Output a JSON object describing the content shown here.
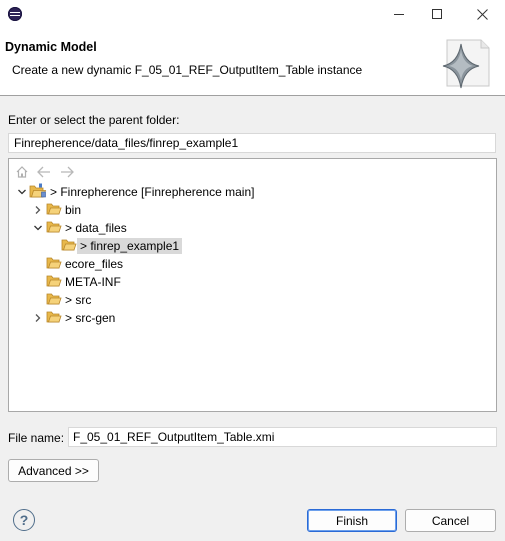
{
  "window": {
    "icon": "eclipse-icon",
    "controls": {
      "minimize": "minimize-icon",
      "maximize": "maximize-icon",
      "close": "close-icon"
    }
  },
  "banner": {
    "title": "Dynamic Model",
    "description": "Create a new dynamic F_05_01_REF_OutputItem_Table instance",
    "image": "wizard-banner-sparkle"
  },
  "folder": {
    "label": "Enter or select the parent folder:",
    "value": "Finrepherence/data_files/finrep_example1"
  },
  "tree_toolbar": {
    "home": "home-icon",
    "back": "back-arrow-icon",
    "forward": "forward-arrow-icon"
  },
  "tree": [
    {
      "label": "> Finrepherence [Finrepherence main]",
      "icon": "project-folder-icon",
      "state": "expanded"
    },
    {
      "label": "bin",
      "icon": "folder-icon",
      "state": "collapsed"
    },
    {
      "label": "> data_files",
      "icon": "folder-icon",
      "state": "expanded"
    },
    {
      "label": "> finrep_example1",
      "icon": "folder-icon",
      "state": "leaf",
      "selected": true
    },
    {
      "label": "ecore_files",
      "icon": "folder-icon",
      "state": "leaf"
    },
    {
      "label": "META-INF",
      "icon": "folder-icon",
      "state": "leaf"
    },
    {
      "label": "> src",
      "icon": "folder-icon",
      "state": "leaf"
    },
    {
      "label": "> src-gen",
      "icon": "folder-icon",
      "state": "collapsed"
    }
  ],
  "file_name": {
    "label": "File name:",
    "value": "F_05_01_REF_OutputItem_Table.xmi"
  },
  "buttons": {
    "advanced": "Advanced >>",
    "finish": "Finish",
    "cancel": "Cancel"
  },
  "help": {
    "icon": "help-icon",
    "glyph": "?"
  },
  "colors": {
    "selection": "#d9d9d9",
    "folder": "#e8b84a",
    "primary_border": "#2a6ad6"
  }
}
